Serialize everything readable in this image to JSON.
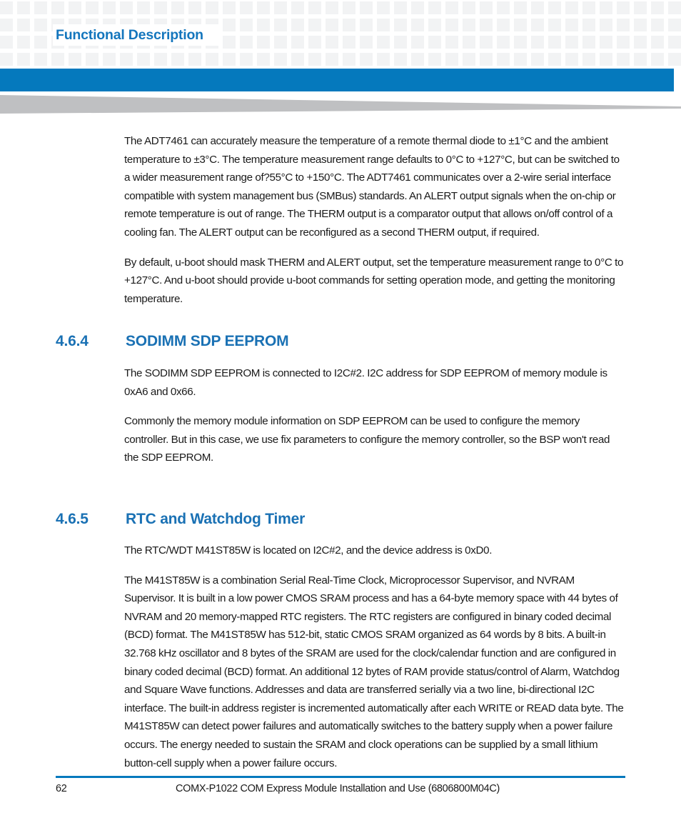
{
  "header": {
    "running_title": "Functional Description"
  },
  "sections": [
    {
      "id": "intro",
      "paragraphs": [
        "The ADT7461 can accurately measure the temperature of a remote thermal diode to ±1°C and the ambient temperature to ±3°C. The temperature measurement range defaults to 0°C to +127°C, but can be switched to a wider measurement range of?55°C to +150°C. The ADT7461 communicates over a 2-wire serial interface compatible with system management bus (SMBus) standards. An ALERT output signals when the on-chip or remote temperature is out of range. The THERM output is a comparator output that allows on/off control of a cooling fan. The ALERT output can be reconfigured as a second THERM output, if required.",
        "By default, u-boot should mask THERM and ALERT output, set the temperature measurement range to 0°C to +127°C. And u-boot should provide u-boot commands for setting operation mode, and getting the monitoring temperature."
      ]
    },
    {
      "id": "sodimm-sdp-eeprom",
      "number": "4.6.4",
      "title": "SODIMM SDP EEPROM",
      "paragraphs": [
        "The SODIMM SDP EEPROM is connected to I2C#2. I2C address for SDP EEPROM of memory module is 0xA6 and 0x66.",
        "Commonly the memory module information on SDP EEPROM can be used to configure the memory controller. But in this case, we use fix parameters to configure the memory controller, so the BSP won't read the SDP EEPROM."
      ]
    },
    {
      "id": "rtc-and-watchdog-timer",
      "number": "4.6.5",
      "title": "RTC and Watchdog Timer",
      "paragraphs": [
        "The RTC/WDT M41ST85W is located on I2C#2, and the device address is 0xD0.",
        "The M41ST85W is a combination Serial Real-Time Clock, Microprocessor Supervisor, and NVRAM Supervisor. It is built in a low power CMOS SRAM process and has a 64-byte memory space with 44 bytes of NVRAM and 20 memory-mapped RTC registers. The RTC registers are configured in binary coded decimal (BCD) format. The M41ST85W has 512-bit, static CMOS SRAM organized as 64 words by 8 bits. A built-in 32.768 kHz oscillator and 8 bytes of the SRAM are used for the clock/calendar function and are configured in binary coded decimal (BCD) format. An additional 12 bytes of RAM provide status/control of Alarm, Watchdog and Square Wave functions. Addresses and data are transferred serially via a two line, bi-directional I2C interface. The built-in address register is incremented automatically after each WRITE or READ data byte. The M41ST85W can detect power failures and automatically switches to the battery supply when a power failure occurs. The energy needed to sustain the SRAM and clock operations can be supplied by a small lithium button-cell supply when a power failure occurs."
      ]
    }
  ],
  "footer": {
    "page_number": "62",
    "document_title": "COMX-P1022 COM Express Module Installation and Use (6806800M04C)"
  },
  "colors": {
    "brand_blue": "#0579bd",
    "heading_blue": "#1a71b4",
    "running_head_blue": "#1476bd",
    "pattern_gray": "#f2f3f4",
    "wedge_gray": "#bfc0c2",
    "body_text": "#1a1a1a"
  }
}
